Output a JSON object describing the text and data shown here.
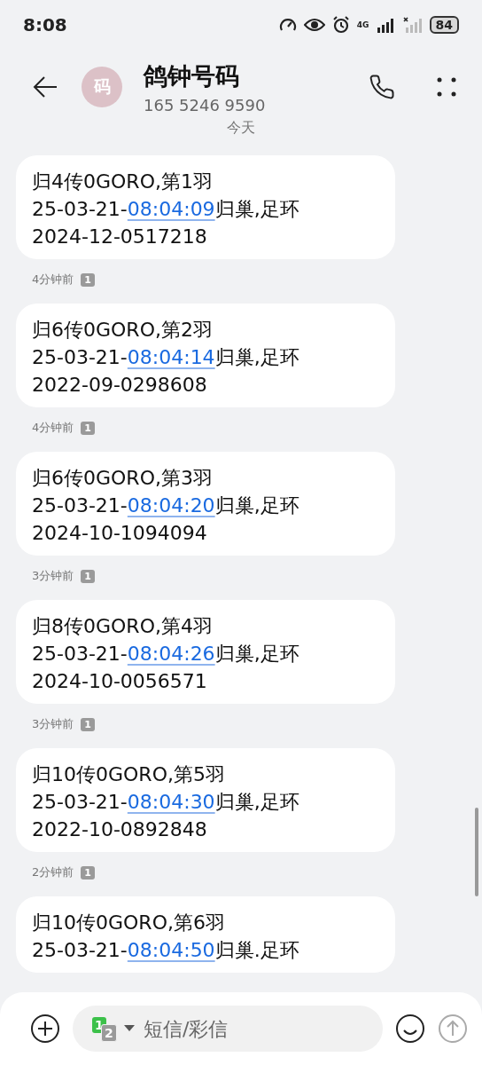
{
  "status_bar": {
    "time": "8:08",
    "network": "4G",
    "battery": "84"
  },
  "header": {
    "avatar": "码",
    "title": "鸽钟号码",
    "number": "165 5246 9590"
  },
  "date_divider": "今天",
  "messages": [
    {
      "title": "归4传0GORO,第1羽",
      "date_prefix": "25-03-21-",
      "time_link": "08:04:09",
      "after_link": "归巢,足环",
      "ring": "2024-12-0517218",
      "ago": "4分钟前",
      "sim": "1"
    },
    {
      "title": "归6传0GORO,第2羽",
      "date_prefix": "25-03-21-",
      "time_link": "08:04:14",
      "after_link": "归巢,足环",
      "ring": "2022-09-0298608",
      "ago": "4分钟前",
      "sim": "1"
    },
    {
      "title": "归6传0GORO,第3羽",
      "date_prefix": "25-03-21-",
      "time_link": "08:04:20",
      "after_link": "归巢,足环",
      "ring": "2024-10-1094094",
      "ago": "3分钟前",
      "sim": "1"
    },
    {
      "title": "归8传0GORO,第4羽",
      "date_prefix": "25-03-21-",
      "time_link": "08:04:26",
      "after_link": "归巢,足环",
      "ring": "2024-10-0056571",
      "ago": "3分钟前",
      "sim": "1"
    },
    {
      "title": "归10传0GORO,第5羽",
      "date_prefix": "25-03-21-",
      "time_link": "08:04:30",
      "after_link": "归巢,足环",
      "ring": "2022-10-0892848",
      "ago": "2分钟前",
      "sim": "1"
    },
    {
      "title": "归10传0GORO,第6羽",
      "date_prefix": "25-03-21-",
      "time_link": "08:04:50",
      "after_link": "归巢.足环"
    }
  ],
  "composer": {
    "sim_primary": "1",
    "sim_secondary": "2",
    "placeholder": "短信/彩信"
  }
}
